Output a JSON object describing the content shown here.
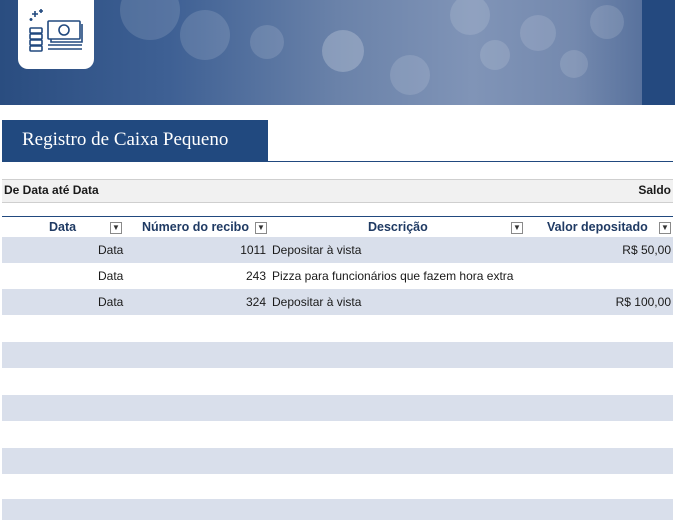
{
  "banner": {
    "logo_icon": "cash-register-icon"
  },
  "title": "Registro de Caixa Pequeno",
  "range": {
    "left": "De Data até Data",
    "right": "Saldo"
  },
  "columns": [
    "Data",
    "Número do recibo",
    "Descrição",
    "Valor depositado"
  ],
  "rows": [
    {
      "date": "Data",
      "receipt": "1011",
      "description": "Depositar à vista",
      "deposit": "R$ 50,00"
    },
    {
      "date": "Data",
      "receipt": "243",
      "description": "Pizza para funcionários que fazem hora extra",
      "deposit": ""
    },
    {
      "date": "Data",
      "receipt": "324",
      "description": "Depositar à vista",
      "deposit": "R$ 100,00"
    }
  ],
  "colors": {
    "accent": "#21497f",
    "band": "#d9dfeb"
  }
}
